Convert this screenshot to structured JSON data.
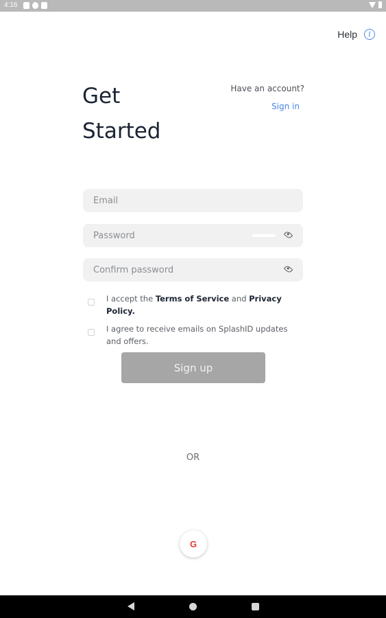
{
  "status_bar": {
    "time": "4:16",
    "icons_left": [
      "notification-icon",
      "notification-icon",
      "notification-icon"
    ],
    "icons_right": [
      "wifi-icon",
      "battery-icon"
    ]
  },
  "header": {
    "help_label": "Help",
    "info_icon_glyph": "i"
  },
  "page": {
    "title_line1": "Get",
    "title_line2": "Started",
    "have_account": "Have an account?",
    "signin_label": "Sign in"
  },
  "form": {
    "email_placeholder": "Email",
    "password_placeholder": "Password",
    "confirm_placeholder": "Confirm password",
    "terms_prefix": "I accept the ",
    "terms_link": "Terms of Service",
    "terms_middle": " and ",
    "privacy_link": "Privacy Policy.",
    "emails_text": "I agree to receive emails on SplashID updates and offers.",
    "signup_label": "Sign up"
  },
  "divider": {
    "or_label": "OR"
  },
  "social": {
    "google_glyph": "G"
  },
  "colors": {
    "accent": "#4a86e8",
    "button_disabled": "#a6a6a6",
    "google_red": "#e53935",
    "input_bg": "#f1f1f1"
  }
}
